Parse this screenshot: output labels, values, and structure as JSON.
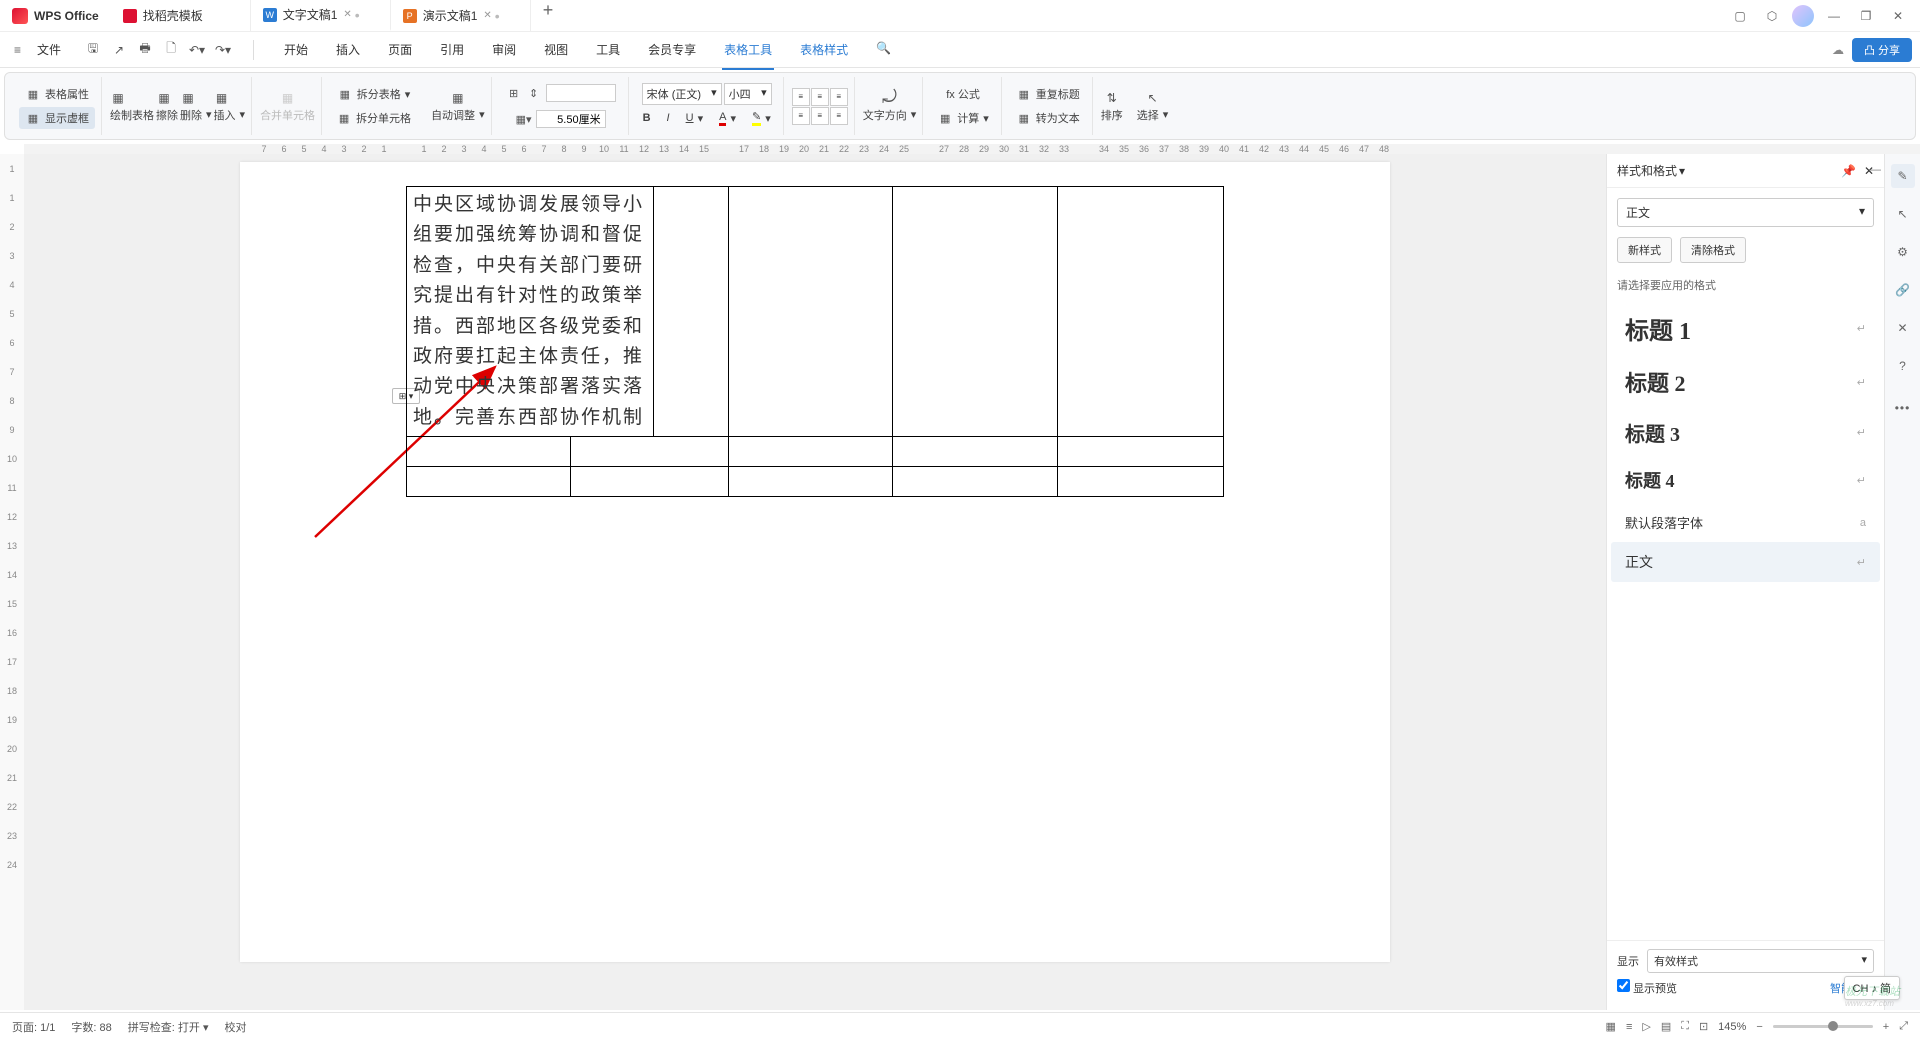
{
  "app": {
    "name": "WPS Office"
  },
  "tabs": [
    {
      "label": "找稻壳模板"
    },
    {
      "label": "文字文稿1"
    },
    {
      "label": "演示文稿1"
    }
  ],
  "menu": {
    "file": "文件",
    "items": [
      "开始",
      "插入",
      "页面",
      "引用",
      "审阅",
      "视图",
      "工具",
      "会员专享",
      "表格工具",
      "表格样式"
    ],
    "share": "凸 分享"
  },
  "ribbon": {
    "tableProps": "表格属性",
    "showGrid": "显示虚框",
    "drawTable": "绘制表格",
    "erase": "擦除",
    "delete": "删除",
    "insert": "插入",
    "mergeCells": "合并单元格",
    "splitTable": "拆分表格",
    "splitCells": "拆分单元格",
    "autoFit": "自动调整",
    "heightVal": "",
    "widthVal": "5.50厘米",
    "font": "宋体 (正文)",
    "fontSize": "小四",
    "textDir": "文字方向",
    "formula": "fx 公式",
    "calc": "计算",
    "repeatHeader": "重复标题",
    "toText": "转为文本",
    "sort": "排序",
    "select": "选择"
  },
  "ruler": [
    7,
    6,
    5,
    4,
    3,
    2,
    1,
    "",
    1,
    2,
    3,
    4,
    5,
    6,
    7,
    8,
    9,
    10,
    11,
    12,
    13,
    14,
    15,
    "",
    17,
    18,
    19,
    20,
    21,
    22,
    23,
    24,
    25,
    "",
    27,
    28,
    29,
    30,
    31,
    32,
    33,
    "",
    34,
    35,
    36,
    37,
    38,
    39,
    40,
    41,
    42,
    43,
    44,
    45,
    46,
    47,
    48
  ],
  "rulerV": [
    1,
    1,
    2,
    3,
    4,
    5,
    6,
    7,
    8,
    9,
    10,
    11,
    12,
    13,
    14,
    15,
    16,
    17,
    18,
    19,
    20,
    21,
    22,
    23,
    24
  ],
  "cellText": "中央区域协调发展领导小组要加强统筹协调和督促检查，中央有关部门要研究提出有针对性的政策举措。西部地区各级党委和政府要扛起主体责任，推动党中央决策部署落实落地。完善东西部协作机制",
  "stylesPanel": {
    "title": "样式和格式",
    "current": "正文",
    "newStyle": "新样式",
    "clearFormat": "清除格式",
    "chooseLabel": "请选择要应用的格式",
    "items": [
      {
        "name": "标题 1",
        "cls": "h1"
      },
      {
        "name": "标题 2",
        "cls": "h2"
      },
      {
        "name": "标题 3",
        "cls": "h3"
      },
      {
        "name": "标题 4",
        "cls": "h4"
      }
    ],
    "defaultFont": "默认段落字体",
    "bodyText": "正文",
    "showLabel": "显示",
    "showValue": "有效样式",
    "preview": "显示预览",
    "smart": "智能排版"
  },
  "statusbar": {
    "page": "页面: 1/1",
    "words": "字数: 88",
    "spell": "拼写检查: 打开",
    "proof": "校对",
    "zoom": "145%"
  },
  "ime": "CH ♪ 简",
  "watermark": {
    "main": "极光下载站",
    "sub": "www.xz7.com"
  }
}
